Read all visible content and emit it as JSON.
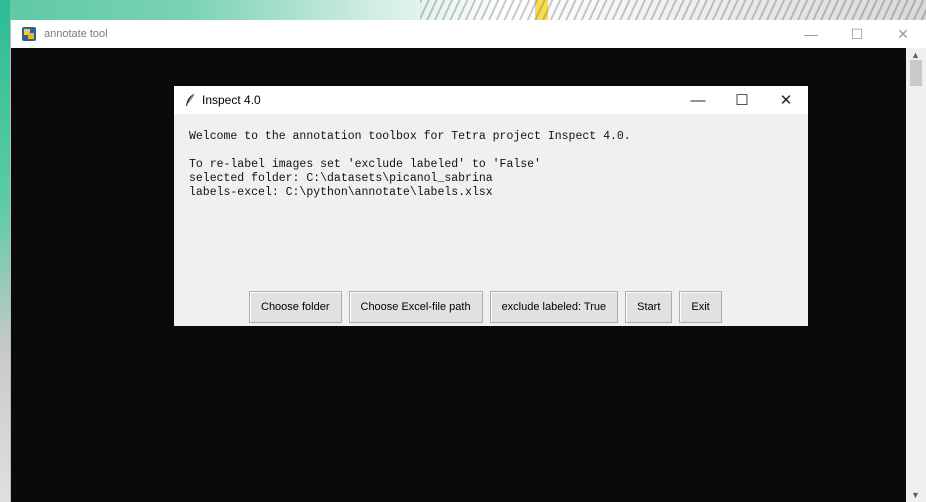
{
  "main_window": {
    "title": "annotate tool",
    "controls": {
      "minimize": "—",
      "maximize": "☐",
      "close": "✕"
    }
  },
  "dialog": {
    "title": "Inspect 4.0",
    "controls": {
      "minimize": "—",
      "maximize": "☐",
      "close": "✕"
    },
    "lines": [
      "Welcome to the annotation toolbox for Tetra project Inspect 4.0.",
      "To re-label images set 'exclude labeled' to 'False'",
      "selected folder: C:\\datasets\\picanol_sabrina",
      "labels-excel: C:\\python\\annotate\\labels.xlsx"
    ],
    "buttons": {
      "choose_folder": "Choose folder",
      "choose_excel": "Choose Excel-file path",
      "exclude_labeled": "exclude labeled: True",
      "start": "Start",
      "exit": "Exit"
    }
  },
  "icons": {
    "app": "python-app-icon",
    "dialog": "feather-icon"
  }
}
